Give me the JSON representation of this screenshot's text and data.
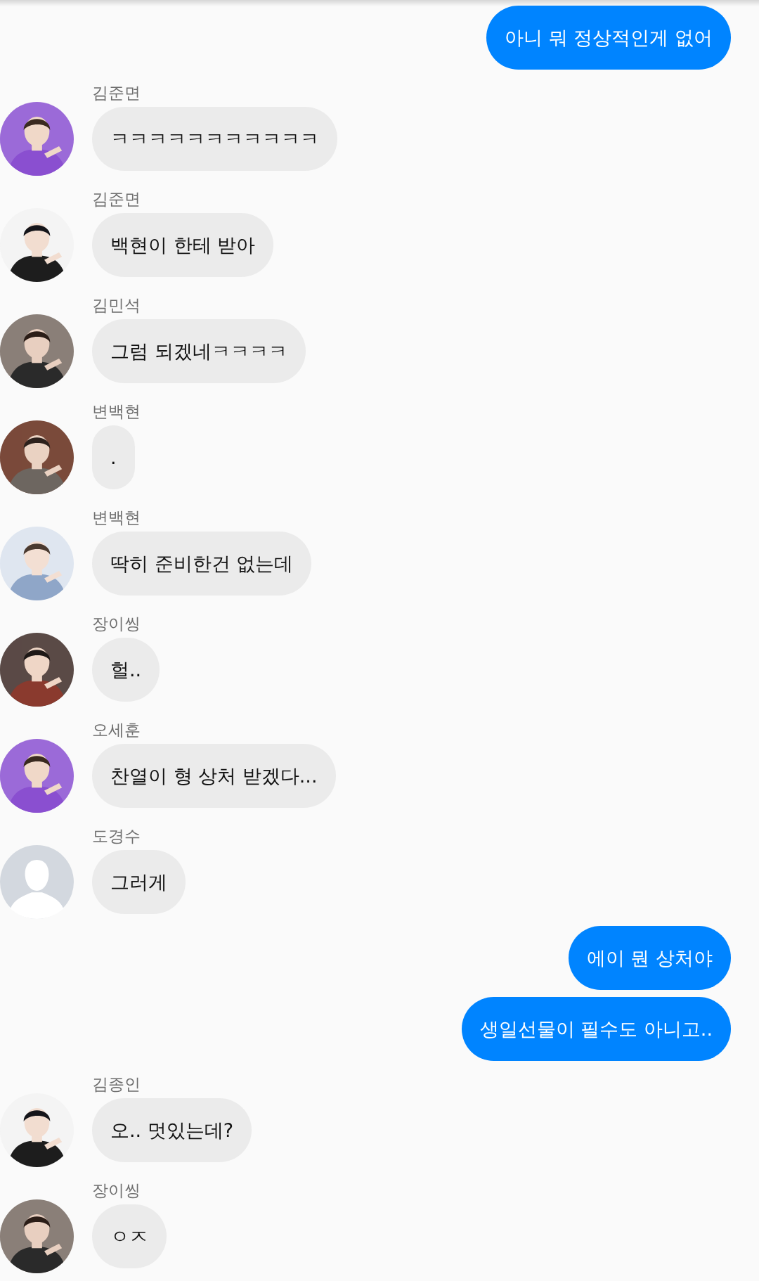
{
  "messages": [
    {
      "kind": "sent",
      "text": "아니 뭐 정상적인게 없어"
    },
    {
      "kind": "received",
      "sender": "김준면",
      "text": "ㅋㅋㅋㅋㅋㅋㅋㅋㅋㅋㅋ"
    },
    {
      "kind": "received",
      "sender": "김준면",
      "text": "백현이 한테 받아"
    },
    {
      "kind": "received",
      "sender": "김민석",
      "text": "그럼 되겠네ㅋㅋㅋㅋ"
    },
    {
      "kind": "received",
      "sender": "변백현",
      "text": "."
    },
    {
      "kind": "received",
      "sender": "변백현",
      "text": "딱히 준비한건 없는데"
    },
    {
      "kind": "received",
      "sender": "장이씽",
      "text": "헐.."
    },
    {
      "kind": "received",
      "sender": "오세훈",
      "text": "찬열이 형 상처 받겠다..."
    },
    {
      "kind": "received",
      "sender": "도경수",
      "avatar": {
        "kind": "silhouette"
      },
      "text": "그러게"
    },
    {
      "kind": "sent",
      "text": "에이 뭔 상처야"
    },
    {
      "kind": "sent",
      "text": "생일선물이 필수도 아니고.."
    },
    {
      "kind": "received",
      "sender": "김종인",
      "text": "오.. 멋있는데?"
    },
    {
      "kind": "received",
      "sender": "장이씽",
      "text": "ㅇㅈ"
    }
  ]
}
